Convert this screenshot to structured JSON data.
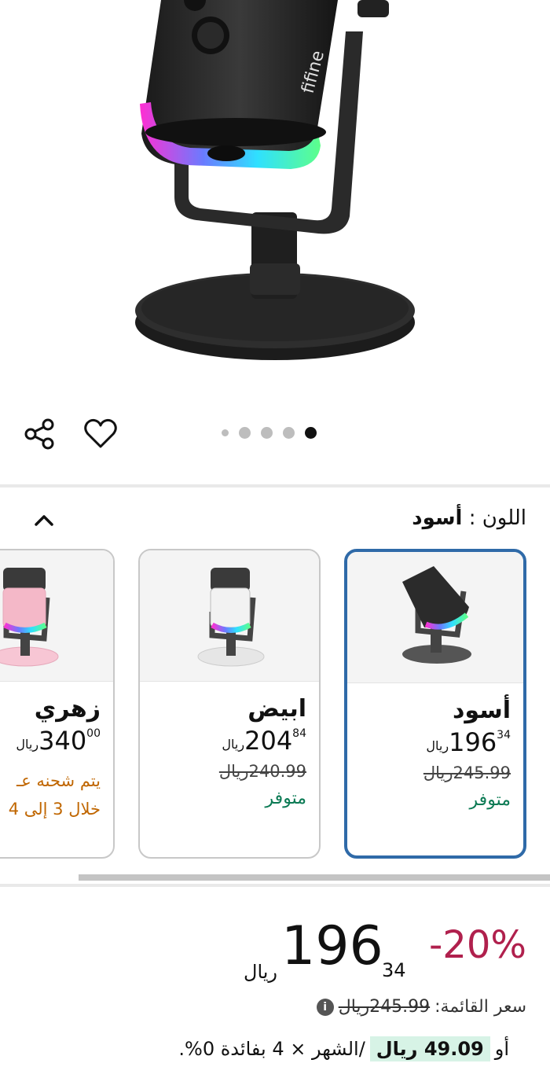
{
  "gallery": {
    "brand": "fifine",
    "dots_count": 5,
    "active_dot": 0
  },
  "actions": {
    "share_icon": "share-icon",
    "wishlist_icon": "heart-icon"
  },
  "variant_selector": {
    "label": "اللون :",
    "selected_value": "أسود"
  },
  "variants": [
    {
      "name": "أسود",
      "currency": "ريال",
      "price_int": "196",
      "price_dec": "34",
      "list_price": "245.99ريال",
      "stock": "متوفر",
      "color": "#2b2b2b"
    },
    {
      "name": "ابيض",
      "currency": "ريال",
      "price_int": "204",
      "price_dec": "84",
      "list_price": "240.99ريال",
      "stock": "متوفر",
      "color": "#f2f2f2"
    },
    {
      "name": "زهري",
      "currency": "ريال",
      "price_int": "340",
      "price_dec": "00",
      "shipping_line1": "يتم شحنه عـ",
      "shipping_line2": "خلال 3 إلى 4",
      "color": "#f4b8c8"
    }
  ],
  "pricing": {
    "discount": "-20%",
    "currency": "ريال",
    "price_int": "196",
    "price_dec": "34",
    "list_label": "سعر القائمة:",
    "list_price": "245.99ريال",
    "installment_prefix": "أو",
    "installment_amount": "49.09 ريال",
    "installment_text": "/الشهر × 4 بفائدة 0%."
  },
  "colors": {
    "selected_border": "#2f6aa8",
    "discount": "#b0204d",
    "in_stock": "#0b7a54",
    "shipping": "#c06600",
    "installment_bg": "#d7f3e6"
  }
}
